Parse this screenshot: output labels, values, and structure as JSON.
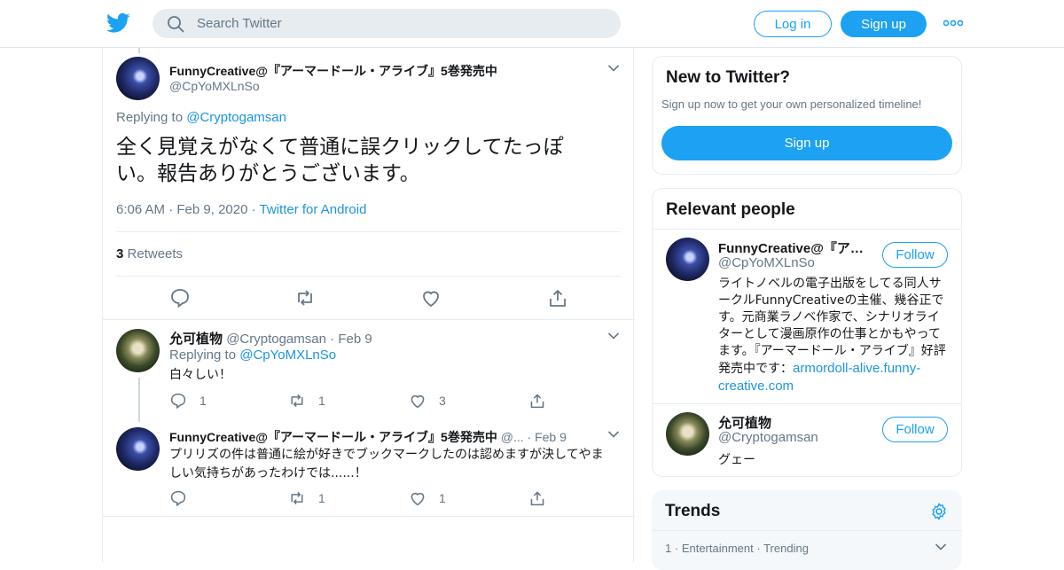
{
  "search": {
    "placeholder": "Search Twitter"
  },
  "header": {
    "login_label": "Log in",
    "signup_label": "Sign up"
  },
  "main_tweet": {
    "author_name": "FunnyCreative@『アーマードール・アライブ』5巻発売中",
    "author_handle": "@CpYoMXLnSo",
    "replying_label": "Replying to",
    "replying_to": "@Cryptogamsan",
    "text": "全く見覚えがなくて普通に誤クリックしてたっぽい。報告ありがとうございます。",
    "time": "6:06 AM",
    "date": "Feb 9, 2020",
    "client": "Twitter for Android",
    "retweet_count": "3",
    "retweet_label": "Retweets"
  },
  "replies": [
    {
      "author_name": "允可植物",
      "author_handle": "@Cryptogamsan",
      "date": "Feb 9",
      "replying_label": "Replying to",
      "replying_to": "@CpYoMXLnSo",
      "text": "白々しい！",
      "reply_count": "1",
      "retweet_count": "1",
      "like_count": "3"
    },
    {
      "author_name": "FunnyCreative@『アーマードール・アライブ』5巻発売中",
      "author_handle": "@...",
      "date": "Feb 9",
      "text": "プリリズの件は普通に絵が好きでブックマークしたのは認めますが決してやましい気持ちがあったわけでは......！",
      "reply_count": "",
      "retweet_count": "1",
      "like_count": "1"
    }
  ],
  "new_to_twitter": {
    "title": "New to Twitter?",
    "subtitle": "Sign up now to get your own personalized timeline!",
    "signup_label": "Sign up"
  },
  "relevant_people": {
    "title": "Relevant people",
    "follow_label": "Follow",
    "people": [
      {
        "name": "FunnyCreative@『ア…",
        "handle": "@CpYoMXLnSo",
        "bio": "ライトノベルの電子出版をしてる同人サークルFunnyCreativeの主催、幾谷正です。元商業ラノベ作家で、シナリオライターとして漫画原作の仕事とかもやってます。『アーマードール・アライブ』好評発売中です：",
        "link": "armordoll-alive.funny-creative.com"
      },
      {
        "name": "允可植物",
        "handle": "@Cryptogamsan",
        "bio": "グェー"
      }
    ]
  },
  "trends": {
    "title": "Trends",
    "items": [
      {
        "rank": "1",
        "category": "Entertainment",
        "label": "Trending"
      }
    ]
  },
  "colors": {
    "accent": "#1da1f2",
    "link": "#1b95e0",
    "muted": "#657786"
  },
  "icons": [
    "twitter-bird-icon",
    "search-icon",
    "more-icon",
    "chevron-down-icon",
    "reply-icon",
    "retweet-icon",
    "like-icon",
    "share-icon",
    "gear-icon"
  ]
}
